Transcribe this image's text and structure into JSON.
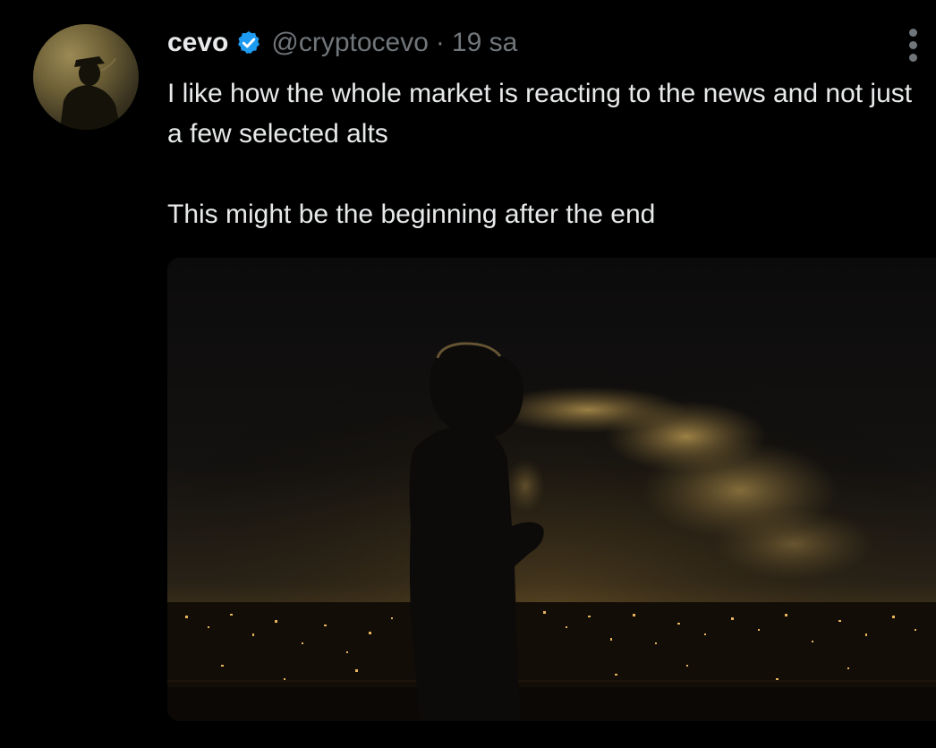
{
  "author": {
    "display_name": "cevo",
    "verified": true,
    "handle": "@cryptocevo",
    "separator": "·",
    "time": "19 sa"
  },
  "tweet": {
    "lines": [
      "I like how the whole market is reacting to the news and not just a few selected alts",
      "This might be the beginning after the end"
    ]
  },
  "icons": {
    "verified": "verified-badge-icon",
    "more": "more-options-icon"
  },
  "colors": {
    "background": "#000000",
    "text_primary": "#e7e9ea",
    "text_secondary": "#71767b",
    "verified_blue": "#1d9bf0"
  }
}
